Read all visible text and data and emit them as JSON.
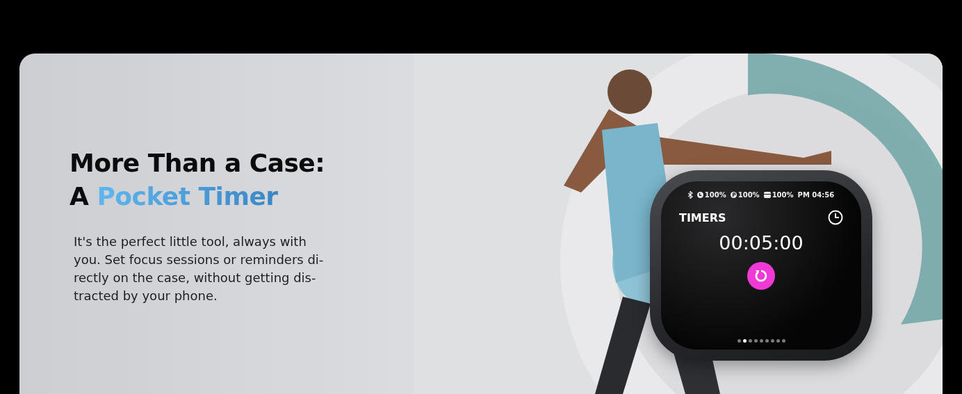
{
  "heading": {
    "line_1": "More Than a Case:",
    "line_2_lead": "A",
    "line_2_highlight": "Pocket Timer"
  },
  "body": "It's the perfect little tool, always with\nyou. Set focus sessions or reminders di-\nrectly on the case, without getting dis-\ntracted by your phone.",
  "device": {
    "status_bar": {
      "batteries": [
        "100%",
        "100%",
        "100%"
      ],
      "time": "PM 04:56"
    },
    "title": "TIMERS",
    "timer": "00:05:00",
    "pager": [
      {
        "selected": false
      },
      {
        "selected": true
      },
      {
        "selected": false
      },
      {
        "selected": false
      },
      {
        "selected": false
      },
      {
        "selected": false
      },
      {
        "selected": false
      },
      {
        "selected": false
      },
      {
        "selected": false
      }
    ]
  }
}
